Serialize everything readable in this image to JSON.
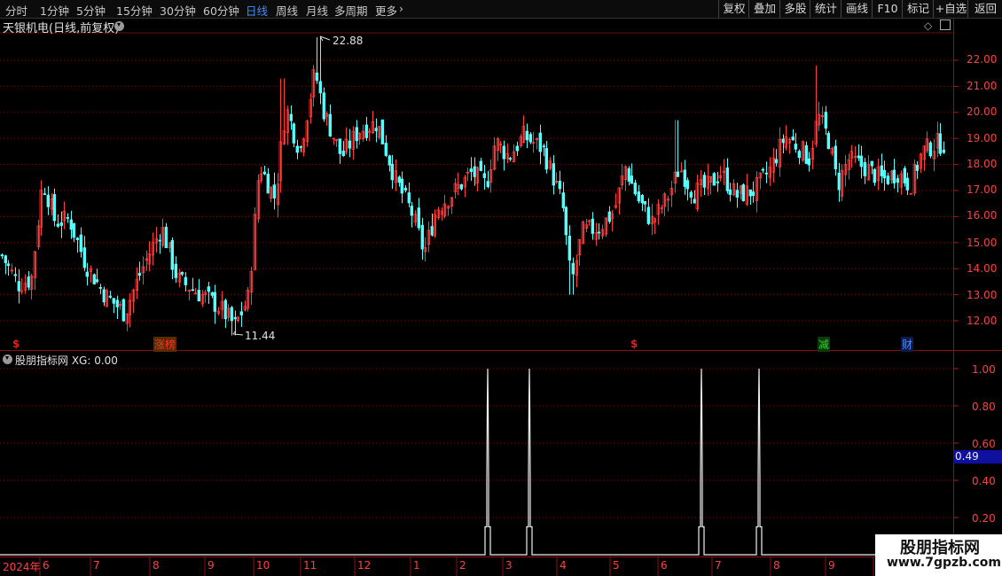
{
  "toolbar": {
    "periods": [
      "分时",
      "1分钟",
      "5分钟",
      "15分钟",
      "30分钟",
      "60分钟",
      "日线",
      "周线",
      "月线",
      "多周期",
      "更多"
    ],
    "active_period": "日线",
    "more_chevron": "›",
    "right_buttons": [
      "复权",
      "叠加",
      "多股",
      "统计",
      "画线",
      "F10",
      "标记",
      "+自选",
      "返回"
    ]
  },
  "stock": {
    "title": "天银机电(日线,前复权)",
    "high_label": "22.88",
    "low_label": "11.44"
  },
  "price_axis": {
    "ticks": [
      "22.00",
      "21.00",
      "20.00",
      "19.00",
      "18.00",
      "17.00",
      "16.00",
      "15.00",
      "14.00",
      "13.00",
      "12.00"
    ]
  },
  "event_markers": [
    {
      "text": "$",
      "color": "#e02020"
    },
    {
      "text": "涨榜",
      "color": "#e02020"
    },
    {
      "text": "$",
      "color": "#e02020"
    },
    {
      "text": "减",
      "color": "#2fd02f"
    },
    {
      "text": "财",
      "color": "#3f7fff"
    }
  ],
  "indicator": {
    "title": "股朋指标网 XG: 0.00",
    "axis_ticks": [
      "1.00",
      "0.80",
      "0.60",
      "0.40",
      "0.20"
    ],
    "current_value": "0.49",
    "signal_count": 4
  },
  "time_axis": {
    "labels": [
      "2024年",
      "6",
      "7",
      "8",
      "9",
      "10",
      "11",
      "12",
      "1",
      "2",
      "3",
      "4",
      "5",
      "6",
      "7",
      "8",
      "9"
    ]
  },
  "watermark": {
    "title": "股朋指标网",
    "url": "www.7gpzb.com"
  },
  "colors": {
    "up": "#ff3c3c",
    "down": "#54ffff",
    "grid": "#7a1010",
    "highlight_period": "#3f8fff",
    "value_box": "#1010a0"
  }
}
